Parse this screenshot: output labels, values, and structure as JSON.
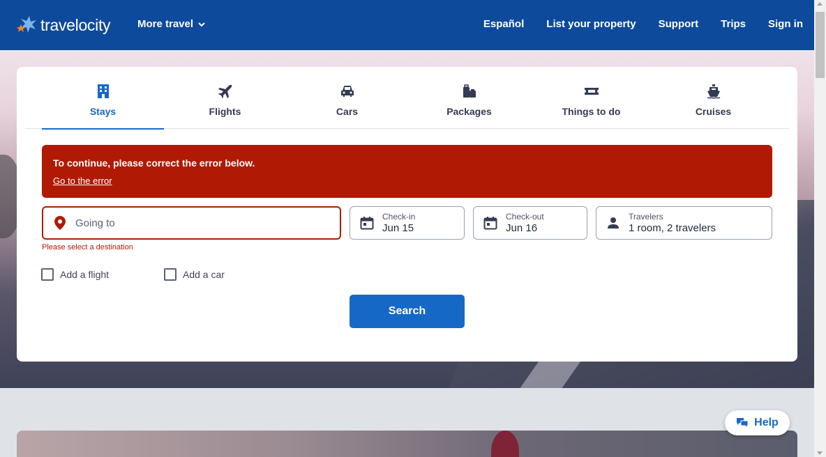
{
  "header": {
    "logo_text": "travelocity",
    "more_travel": "More travel",
    "links": [
      "Español",
      "List your property",
      "Support",
      "Trips",
      "Sign in"
    ]
  },
  "tabs": [
    {
      "label": "Stays",
      "icon": "hotel-building-icon",
      "active": true
    },
    {
      "label": "Flights",
      "icon": "airplane-icon",
      "active": false
    },
    {
      "label": "Cars",
      "icon": "car-icon",
      "active": false
    },
    {
      "label": "Packages",
      "icon": "luggage-icon",
      "active": false
    },
    {
      "label": "Things to do",
      "icon": "ticket-icon",
      "active": false
    },
    {
      "label": "Cruises",
      "icon": "cruise-ship-icon",
      "active": false
    }
  ],
  "alert": {
    "title": "To continue, please correct the error below.",
    "link": "Go to the error"
  },
  "search": {
    "going_to_placeholder": "Going to",
    "going_to_error": "Please select a destination",
    "checkin_label": "Check-in",
    "checkin_value": "Jun 15",
    "checkout_label": "Check-out",
    "checkout_value": "Jun 16",
    "travelers_label": "Travelers",
    "travelers_value": "1 room, 2 travelers",
    "add_flight": "Add a flight",
    "add_car": "Add a car",
    "search_button": "Search"
  },
  "help": {
    "label": "Help"
  },
  "colors": {
    "header_bg": "#0e4a9c",
    "accent": "#1668c7",
    "error": "#b01a04"
  }
}
